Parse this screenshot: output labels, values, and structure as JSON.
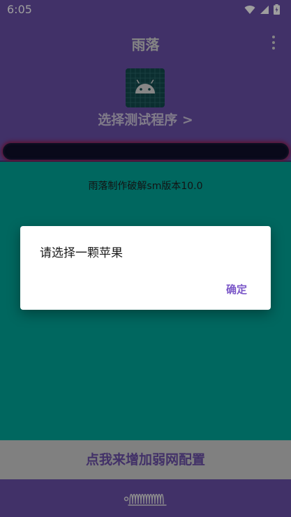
{
  "status_bar": {
    "time": "6:05",
    "icons": [
      "wifi-icon",
      "cellular-signal-icon",
      "battery-icon"
    ]
  },
  "app_bar": {
    "title": "雨落",
    "menu_icon": "more-vert-icon"
  },
  "header": {
    "app_icon": "android-icon",
    "select_program_label": "选择测试程序 >"
  },
  "main": {
    "version_text": "雨落制作破解sm版本10.0"
  },
  "weak_net_button": {
    "label": "点我来增加弱网配置"
  },
  "bottom_bar": {
    "logo": "signature-logo"
  },
  "dialog": {
    "message": "请选择一颗苹果",
    "ok_label": "确定"
  },
  "colors": {
    "header_purple": "#6a4fa8",
    "teal": "#00a69a",
    "accent": "#7b57c8"
  }
}
